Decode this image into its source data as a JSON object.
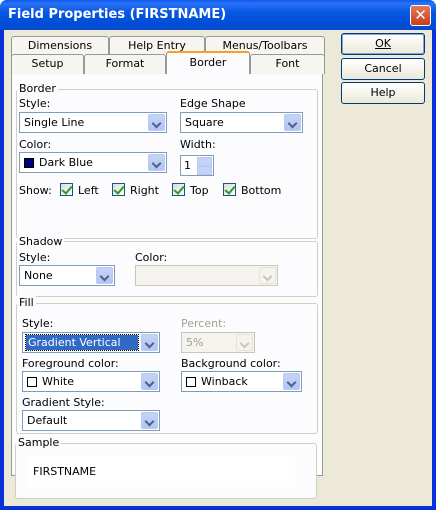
{
  "window": {
    "title": "Field Properties (FIRSTNAME)",
    "close_glyph": "✕"
  },
  "tabs_row1": [
    {
      "label": "Dimensions"
    },
    {
      "label": "Help Entry"
    },
    {
      "label": "Menus/Toolbars"
    }
  ],
  "tabs_row2": [
    {
      "label": "Setup"
    },
    {
      "label": "Format"
    },
    {
      "label": "Border",
      "active": true
    },
    {
      "label": "Font"
    }
  ],
  "buttons": {
    "ok": "OK",
    "cancel": "Cancel",
    "help": "Help"
  },
  "border": {
    "group_label": "Border",
    "style_label": "Style:",
    "style_value": "Single Line",
    "edge_label": "Edge Shape",
    "edge_value": "Square",
    "color_label": "Color:",
    "color_value": "Dark Blue",
    "color_hex": "#000080",
    "width_label": "Width:",
    "width_value": "1",
    "show_label": "Show:",
    "show": {
      "left": "Left",
      "right": "Right",
      "top": "Top",
      "bottom": "Bottom"
    }
  },
  "shadow": {
    "group_label": "Shadow",
    "style_label": "Style:",
    "style_value": "None",
    "color_label": "Color:"
  },
  "fill": {
    "group_label": "Fill",
    "style_label": "Style:",
    "style_value": "Gradient Vertical",
    "percent_label": "Percent:",
    "percent_value": "5%",
    "fg_label": "Foreground color:",
    "fg_value": "White",
    "bg_label": "Background color:",
    "bg_value": "Winback",
    "gradient_label": "Gradient Style:",
    "gradient_value": "Default"
  },
  "sample": {
    "group_label": "Sample",
    "text": "FIRSTNAME"
  },
  "colors": {
    "title_bar": "#0054e3",
    "active_tab_accent": "#f7a128",
    "selection": "#316ac5"
  }
}
